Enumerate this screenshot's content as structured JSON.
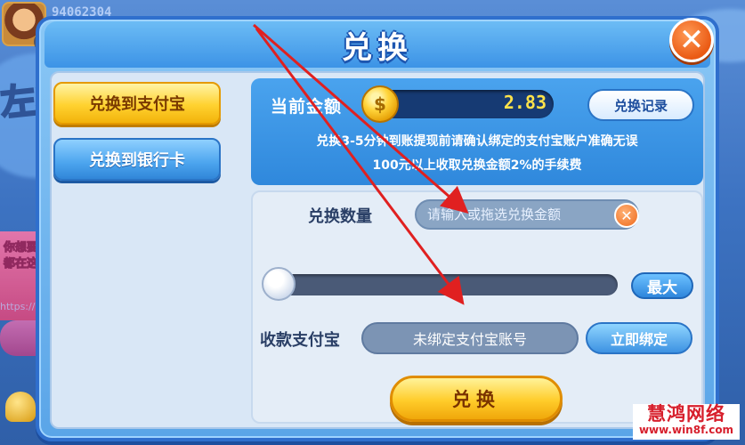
{
  "background": {
    "player_id": "94062304",
    "side_banner": "你想要的都在这里",
    "site_url": "https://www.zuoyoudipai.com",
    "big_text": "左右"
  },
  "dialog": {
    "title": "兑换",
    "close_glyph": "✕"
  },
  "tabs": [
    {
      "label": "兑换到支付宝",
      "active": true
    },
    {
      "label": "兑换到银行卡",
      "active": false
    }
  ],
  "balance": {
    "label": "当前金额",
    "value": "2.83",
    "coin_glyph": "$",
    "record_button": "兑换记录"
  },
  "notice": {
    "line1": "兑换3-5分钟到账提现前请确认绑定的支付宝账户准确无误",
    "line2": "100元以上收取兑换金额2%的手续费"
  },
  "form": {
    "amount_label": "兑换数量",
    "amount_placeholder": "请输入或拖选兑换金额",
    "clear_glyph": "✕",
    "slider_value": 0,
    "max_button": "最大",
    "account_label": "收款支付宝",
    "account_value": "未绑定支付宝账号",
    "bind_button": "立即绑定",
    "submit_button": "兑换"
  },
  "watermark": {
    "line1": "慧鸿网络",
    "line2": "www.win8f.com"
  },
  "colors": {
    "accent_blue": "#2f88dc",
    "accent_yellow": "#ffd230",
    "close_orange": "#ea5a14",
    "arrow_red": "#e02020"
  }
}
